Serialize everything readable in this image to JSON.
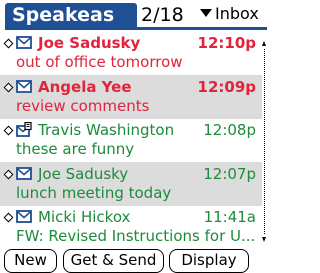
{
  "header": {
    "app_title": "Speakeas",
    "counter": "2/18",
    "folder": "Inbox"
  },
  "messages": [
    {
      "sender": "Joe Sadusky",
      "time": "12:10p",
      "subject": "out of office tomorrow",
      "status": "unread",
      "icon": "envelope-icon",
      "shaded": false
    },
    {
      "sender": "Angela Yee",
      "time": "12:09p",
      "subject": "review comments",
      "status": "unread",
      "icon": "envelope-icon",
      "shaded": true
    },
    {
      "sender": "Travis Washington",
      "time": "12:08p",
      "subject": "these are funny",
      "status": "read",
      "icon": "envelope-attachment-icon",
      "shaded": false
    },
    {
      "sender": "Joe Sadusky",
      "time": "12:07p",
      "subject": "lunch meeting today",
      "status": "read",
      "icon": "envelope-icon",
      "shaded": true
    },
    {
      "sender": "Micki Hickox",
      "time": "11:41a",
      "subject": "FW: Revised Instructions for U...",
      "status": "read",
      "icon": "envelope-icon",
      "shaded": false
    }
  ],
  "buttons": {
    "new": "New",
    "get_send": "Get & Send",
    "display": "Display"
  },
  "colors": {
    "title_bar": "#1f4f95",
    "unread_text": "#e0243c",
    "read_text": "#1c8c3a",
    "row_shade": "#dcdcdc"
  }
}
